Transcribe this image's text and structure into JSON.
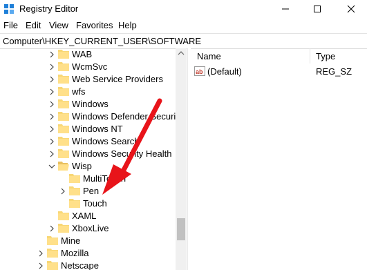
{
  "window": {
    "title": "Registry Editor"
  },
  "menu": [
    "File",
    "Edit",
    "View",
    "Favorites",
    "Help"
  ],
  "address": "Computer\\HKEY_CURRENT_USER\\SOFTWARE",
  "tree": [
    {
      "label": "WAB",
      "state": "collapsed"
    },
    {
      "label": "WcmSvc",
      "state": "collapsed"
    },
    {
      "label": "Web Service Providers",
      "state": "collapsed"
    },
    {
      "label": "wfs",
      "state": "collapsed"
    },
    {
      "label": "Windows",
      "state": "collapsed"
    },
    {
      "label": "Windows Defender Security",
      "state": "collapsed"
    },
    {
      "label": "Windows NT",
      "state": "collapsed"
    },
    {
      "label": "Windows Search",
      "state": "collapsed"
    },
    {
      "label": "Windows Security Health",
      "state": "collapsed"
    },
    {
      "label": "Wisp",
      "state": "expanded"
    },
    {
      "label": "MultiTouch",
      "state": "leaf"
    },
    {
      "label": "Pen",
      "state": "collapsed"
    },
    {
      "label": "Touch",
      "state": "leaf"
    },
    {
      "label": "XAML",
      "state": "leaf"
    },
    {
      "label": "XboxLive",
      "state": "collapsed"
    },
    {
      "label": "Mine",
      "state": "leaf"
    },
    {
      "label": "Mozilla",
      "state": "collapsed"
    },
    {
      "label": "Netscape",
      "state": "collapsed"
    }
  ],
  "list": {
    "columns": [
      "Name",
      "Type"
    ],
    "rows": [
      {
        "name": "(Default)",
        "type": "REG_SZ",
        "icon": "string-value-icon"
      }
    ]
  },
  "annotation": {
    "arrow_color": "#e8141a"
  }
}
